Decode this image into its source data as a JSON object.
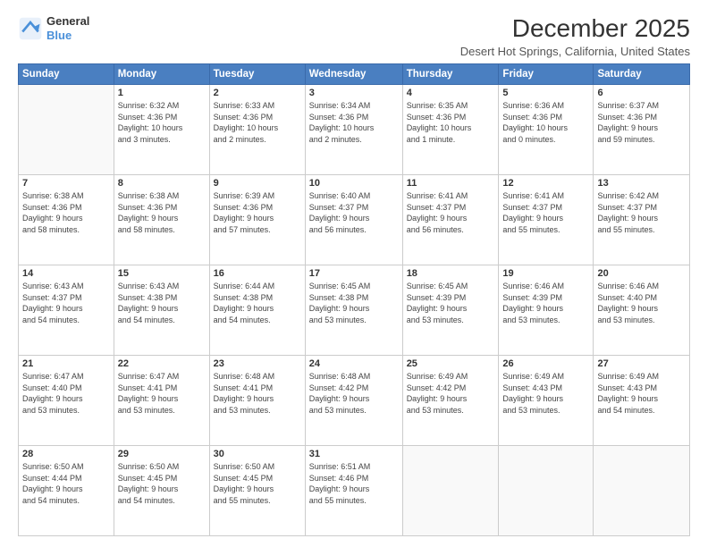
{
  "logo": {
    "line1": "General",
    "line2": "Blue"
  },
  "title": "December 2025",
  "subtitle": "Desert Hot Springs, California, United States",
  "days_header": [
    "Sunday",
    "Monday",
    "Tuesday",
    "Wednesday",
    "Thursday",
    "Friday",
    "Saturday"
  ],
  "weeks": [
    [
      {
        "day": "",
        "info": ""
      },
      {
        "day": "1",
        "info": "Sunrise: 6:32 AM\nSunset: 4:36 PM\nDaylight: 10 hours\nand 3 minutes."
      },
      {
        "day": "2",
        "info": "Sunrise: 6:33 AM\nSunset: 4:36 PM\nDaylight: 10 hours\nand 2 minutes."
      },
      {
        "day": "3",
        "info": "Sunrise: 6:34 AM\nSunset: 4:36 PM\nDaylight: 10 hours\nand 2 minutes."
      },
      {
        "day": "4",
        "info": "Sunrise: 6:35 AM\nSunset: 4:36 PM\nDaylight: 10 hours\nand 1 minute."
      },
      {
        "day": "5",
        "info": "Sunrise: 6:36 AM\nSunset: 4:36 PM\nDaylight: 10 hours\nand 0 minutes."
      },
      {
        "day": "6",
        "info": "Sunrise: 6:37 AM\nSunset: 4:36 PM\nDaylight: 9 hours\nand 59 minutes."
      }
    ],
    [
      {
        "day": "7",
        "info": "Sunrise: 6:38 AM\nSunset: 4:36 PM\nDaylight: 9 hours\nand 58 minutes."
      },
      {
        "day": "8",
        "info": "Sunrise: 6:38 AM\nSunset: 4:36 PM\nDaylight: 9 hours\nand 58 minutes."
      },
      {
        "day": "9",
        "info": "Sunrise: 6:39 AM\nSunset: 4:36 PM\nDaylight: 9 hours\nand 57 minutes."
      },
      {
        "day": "10",
        "info": "Sunrise: 6:40 AM\nSunset: 4:37 PM\nDaylight: 9 hours\nand 56 minutes."
      },
      {
        "day": "11",
        "info": "Sunrise: 6:41 AM\nSunset: 4:37 PM\nDaylight: 9 hours\nand 56 minutes."
      },
      {
        "day": "12",
        "info": "Sunrise: 6:41 AM\nSunset: 4:37 PM\nDaylight: 9 hours\nand 55 minutes."
      },
      {
        "day": "13",
        "info": "Sunrise: 6:42 AM\nSunset: 4:37 PM\nDaylight: 9 hours\nand 55 minutes."
      }
    ],
    [
      {
        "day": "14",
        "info": "Sunrise: 6:43 AM\nSunset: 4:37 PM\nDaylight: 9 hours\nand 54 minutes."
      },
      {
        "day": "15",
        "info": "Sunrise: 6:43 AM\nSunset: 4:38 PM\nDaylight: 9 hours\nand 54 minutes."
      },
      {
        "day": "16",
        "info": "Sunrise: 6:44 AM\nSunset: 4:38 PM\nDaylight: 9 hours\nand 54 minutes."
      },
      {
        "day": "17",
        "info": "Sunrise: 6:45 AM\nSunset: 4:38 PM\nDaylight: 9 hours\nand 53 minutes."
      },
      {
        "day": "18",
        "info": "Sunrise: 6:45 AM\nSunset: 4:39 PM\nDaylight: 9 hours\nand 53 minutes."
      },
      {
        "day": "19",
        "info": "Sunrise: 6:46 AM\nSunset: 4:39 PM\nDaylight: 9 hours\nand 53 minutes."
      },
      {
        "day": "20",
        "info": "Sunrise: 6:46 AM\nSunset: 4:40 PM\nDaylight: 9 hours\nand 53 minutes."
      }
    ],
    [
      {
        "day": "21",
        "info": "Sunrise: 6:47 AM\nSunset: 4:40 PM\nDaylight: 9 hours\nand 53 minutes."
      },
      {
        "day": "22",
        "info": "Sunrise: 6:47 AM\nSunset: 4:41 PM\nDaylight: 9 hours\nand 53 minutes."
      },
      {
        "day": "23",
        "info": "Sunrise: 6:48 AM\nSunset: 4:41 PM\nDaylight: 9 hours\nand 53 minutes."
      },
      {
        "day": "24",
        "info": "Sunrise: 6:48 AM\nSunset: 4:42 PM\nDaylight: 9 hours\nand 53 minutes."
      },
      {
        "day": "25",
        "info": "Sunrise: 6:49 AM\nSunset: 4:42 PM\nDaylight: 9 hours\nand 53 minutes."
      },
      {
        "day": "26",
        "info": "Sunrise: 6:49 AM\nSunset: 4:43 PM\nDaylight: 9 hours\nand 53 minutes."
      },
      {
        "day": "27",
        "info": "Sunrise: 6:49 AM\nSunset: 4:43 PM\nDaylight: 9 hours\nand 54 minutes."
      }
    ],
    [
      {
        "day": "28",
        "info": "Sunrise: 6:50 AM\nSunset: 4:44 PM\nDaylight: 9 hours\nand 54 minutes."
      },
      {
        "day": "29",
        "info": "Sunrise: 6:50 AM\nSunset: 4:45 PM\nDaylight: 9 hours\nand 54 minutes."
      },
      {
        "day": "30",
        "info": "Sunrise: 6:50 AM\nSunset: 4:45 PM\nDaylight: 9 hours\nand 55 minutes."
      },
      {
        "day": "31",
        "info": "Sunrise: 6:51 AM\nSunset: 4:46 PM\nDaylight: 9 hours\nand 55 minutes."
      },
      {
        "day": "",
        "info": ""
      },
      {
        "day": "",
        "info": ""
      },
      {
        "day": "",
        "info": ""
      }
    ]
  ]
}
